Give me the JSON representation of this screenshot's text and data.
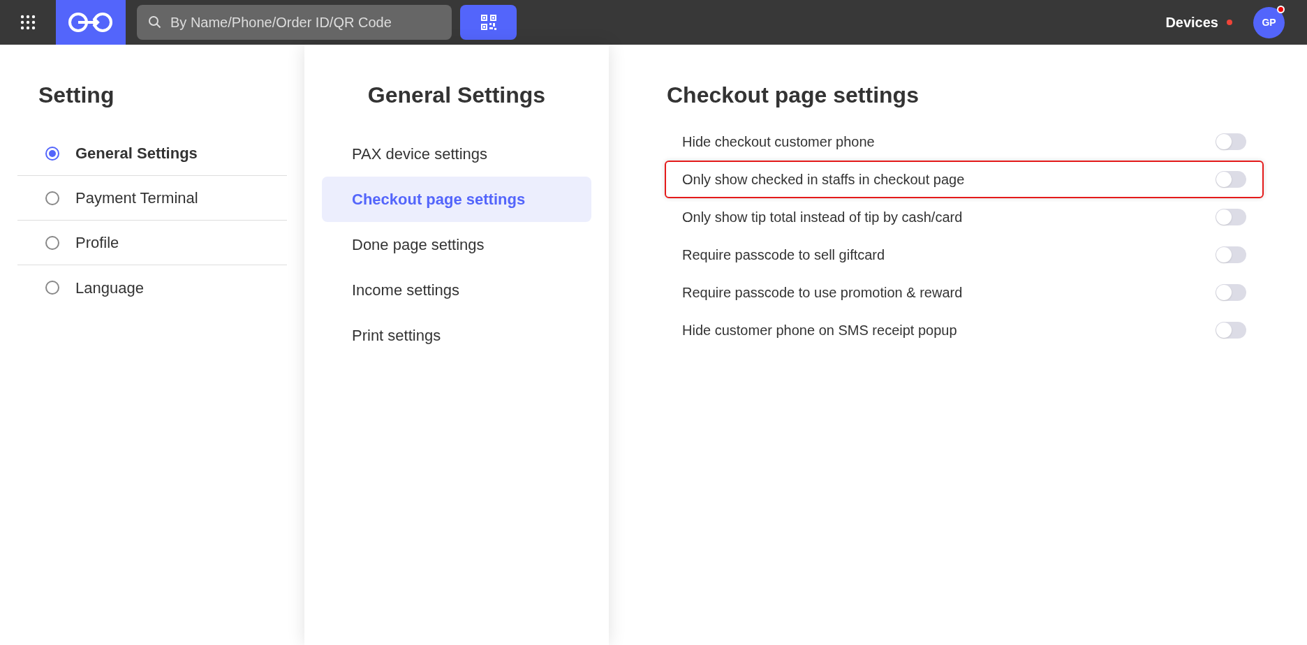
{
  "top_bar": {
    "search": {
      "placeholder": "By Name/Phone/Order ID/QR Code"
    },
    "devices": {
      "label": "Devices",
      "alert": true
    },
    "avatar": {
      "initials": "GP",
      "alert": true
    }
  },
  "sidebar": {
    "title": "Setting",
    "items": [
      {
        "label": "General Settings",
        "selected": true
      },
      {
        "label": "Payment Terminal",
        "selected": false
      },
      {
        "label": "Profile",
        "selected": false
      },
      {
        "label": "Language",
        "selected": false
      }
    ]
  },
  "submenu": {
    "title": "General Settings",
    "items": [
      {
        "label": "PAX device settings",
        "selected": false
      },
      {
        "label": "Checkout page settings",
        "selected": true
      },
      {
        "label": "Done page settings",
        "selected": false
      },
      {
        "label": "Income settings",
        "selected": false
      },
      {
        "label": "Print settings",
        "selected": false
      }
    ]
  },
  "content": {
    "title": "Checkout page settings",
    "settings": [
      {
        "label": "Hide checkout customer phone",
        "on": false,
        "highlighted": false
      },
      {
        "label": "Only show checked in staffs in checkout page",
        "on": false,
        "highlighted": true
      },
      {
        "label": "Only show tip total instead of tip by cash/card",
        "on": false,
        "highlighted": false
      },
      {
        "label": "Require passcode to sell giftcard",
        "on": false,
        "highlighted": false
      },
      {
        "label": "Require passcode to use promotion & reward",
        "on": false,
        "highlighted": false
      },
      {
        "label": "Hide customer phone on SMS receipt popup",
        "on": false,
        "highlighted": false
      }
    ]
  }
}
